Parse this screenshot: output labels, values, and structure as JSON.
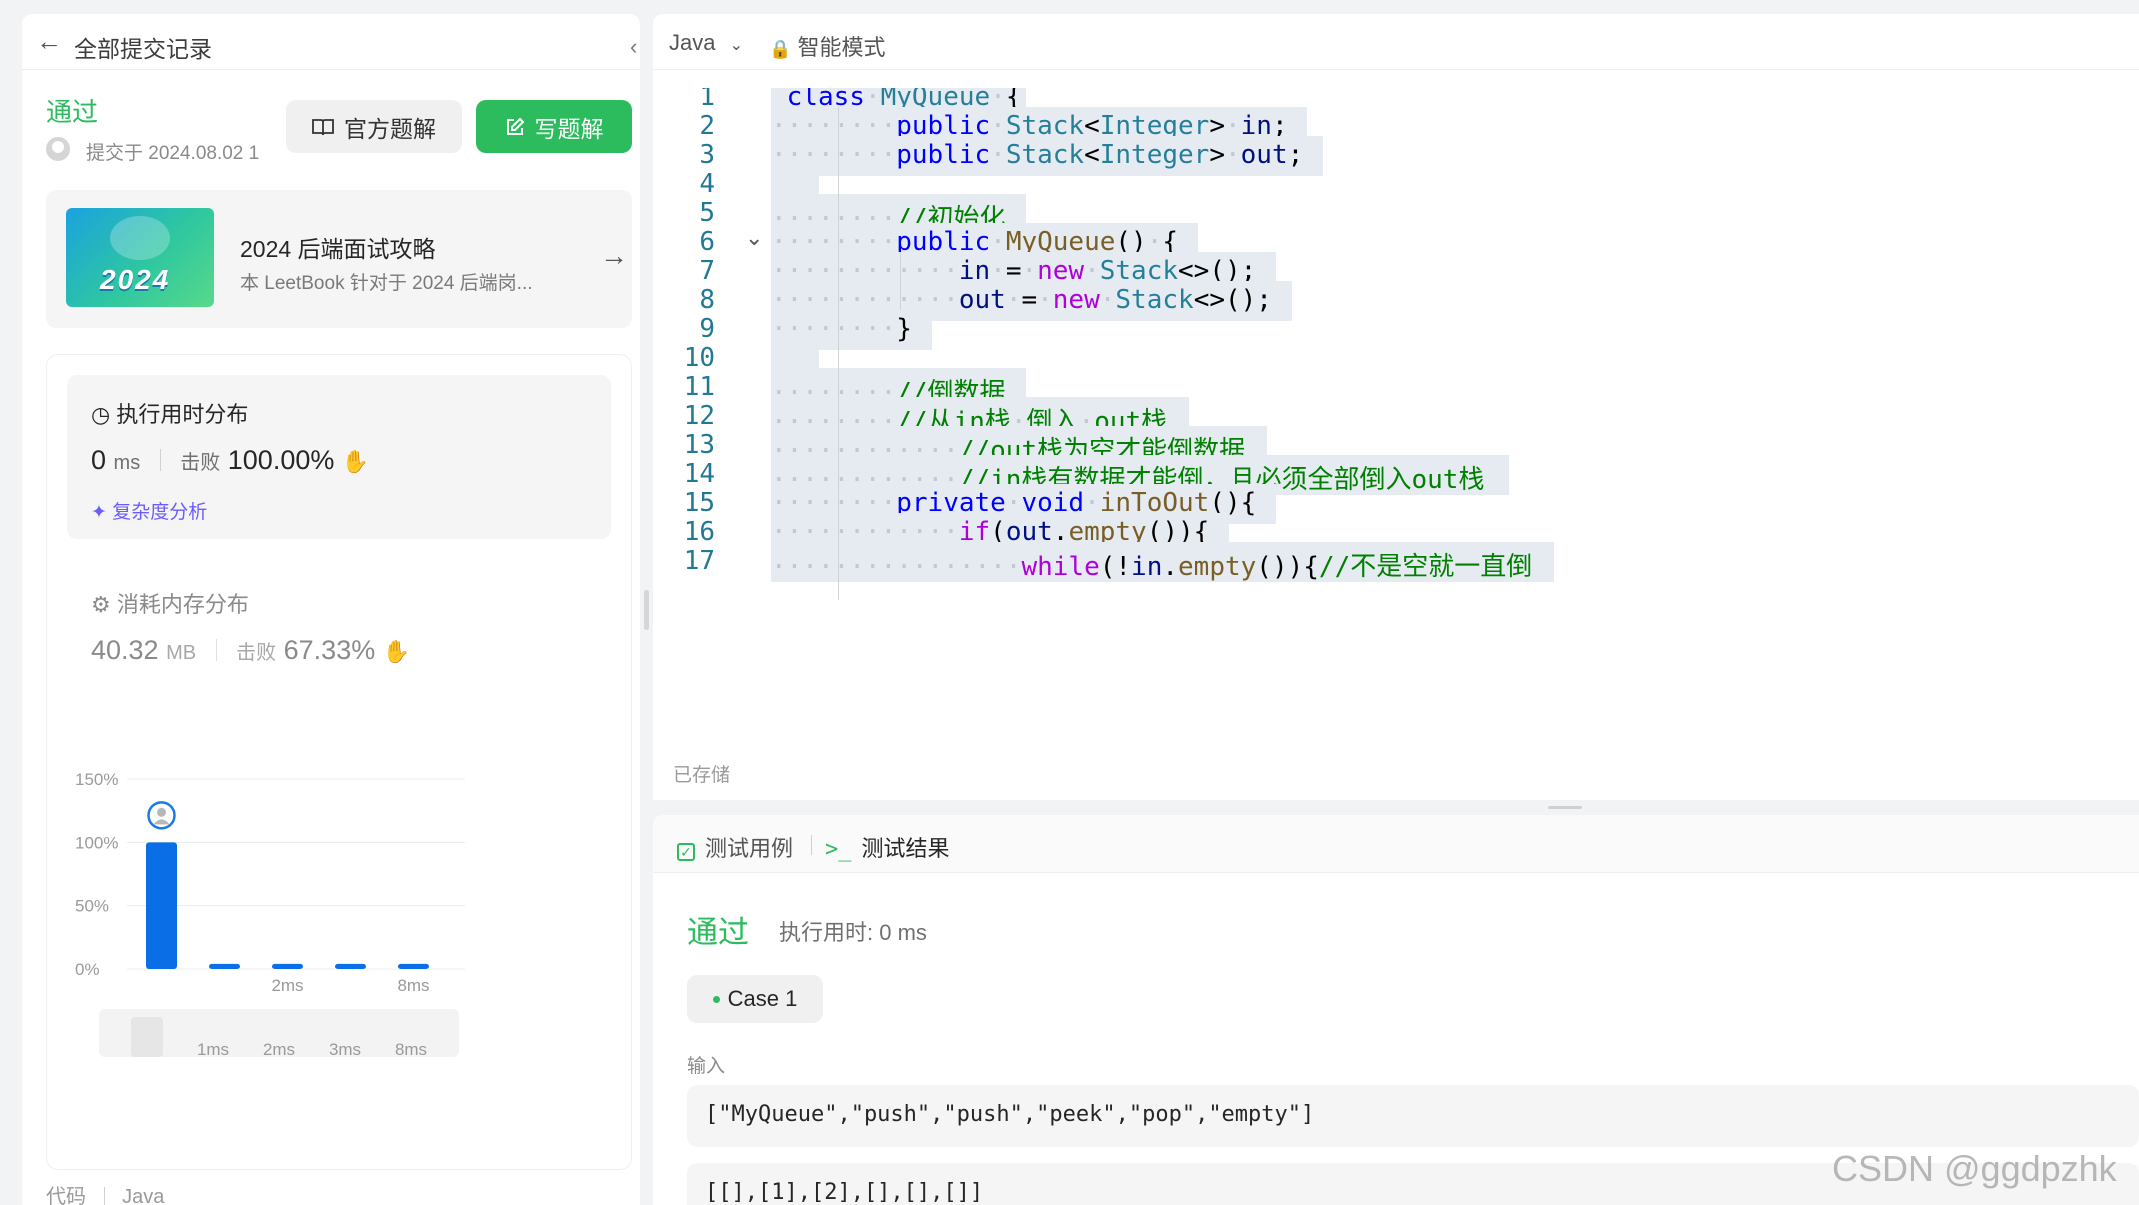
{
  "left_panel": {
    "back_title": "全部提交记录",
    "status": "通过",
    "submitted_at": "提交于 2024.08.02 1",
    "official_solution_label": "官方题解",
    "write_solution_label": "写题解",
    "book": {
      "cover_year": "2024",
      "title": "2024 后端面试攻略",
      "description": "本 LeetBook 针对于 2024 后端岗..."
    },
    "runtime": {
      "title": "执行用时分布",
      "value": "0",
      "unit": "ms",
      "beat_label": "击败",
      "beat_pct": "100.00%",
      "complexity_link": "复杂度分析"
    },
    "memory": {
      "title": "消耗内存分布",
      "value": "40.32",
      "unit": "MB",
      "beat_label": "击败",
      "beat_pct": "67.33%"
    },
    "code_label": "代码",
    "code_lang": "Java"
  },
  "chart_data": {
    "type": "bar",
    "y_ticks": [
      "150%",
      "100%",
      "50%",
      "0%"
    ],
    "ylim": [
      0,
      150
    ],
    "x_labels_main": [
      "",
      "2ms",
      "",
      "8ms"
    ],
    "x_labels_overview": [
      "1ms",
      "2ms",
      "3ms",
      "8ms"
    ],
    "values": [
      100,
      4,
      4,
      4,
      4
    ],
    "colors": {
      "bar": "#0a6fe6",
      "overview_handle": "#e6e6e6"
    }
  },
  "editor": {
    "language": "Java",
    "smart_mode": "智能模式",
    "saved_label": "已存储",
    "lines": [
      {
        "n": "1",
        "indent": 0,
        "tokens": [
          [
            "kw",
            "class"
          ],
          [
            "sp",
            " "
          ],
          [
            "ty",
            "MyQueue"
          ],
          [
            "sp",
            " "
          ],
          [
            "pl",
            "{"
          ]
        ]
      },
      {
        "n": "2",
        "indent": 2,
        "tokens": [
          [
            "kw",
            "public"
          ],
          [
            "sp",
            " "
          ],
          [
            "ty",
            "Stack"
          ],
          [
            "pl",
            "<"
          ],
          [
            "ty",
            "Integer"
          ],
          [
            "pl",
            ">"
          ],
          [
            "sp",
            " "
          ],
          [
            "id",
            "in"
          ],
          [
            "pl",
            ";"
          ]
        ]
      },
      {
        "n": "3",
        "indent": 2,
        "tokens": [
          [
            "kw",
            "public"
          ],
          [
            "sp",
            " "
          ],
          [
            "ty",
            "Stack"
          ],
          [
            "pl",
            "<"
          ],
          [
            "ty",
            "Integer"
          ],
          [
            "pl",
            ">"
          ],
          [
            "sp",
            " "
          ],
          [
            "id",
            "out"
          ],
          [
            "pl",
            ";"
          ]
        ]
      },
      {
        "n": "4",
        "indent": 0,
        "tokens": []
      },
      {
        "n": "5",
        "indent": 2,
        "tokens": [
          [
            "cm",
            "//初始化"
          ]
        ]
      },
      {
        "n": "6",
        "indent": 2,
        "fold": true,
        "tokens": [
          [
            "kw",
            "public"
          ],
          [
            "sp",
            " "
          ],
          [
            "fn",
            "MyQueue"
          ],
          [
            "pl",
            "()"
          ],
          [
            "sp",
            " "
          ],
          [
            "pl",
            "{"
          ]
        ]
      },
      {
        "n": "7",
        "indent": 3,
        "tokens": [
          [
            "id",
            "in"
          ],
          [
            "sp",
            " "
          ],
          [
            "pl",
            "="
          ],
          [
            "sp",
            " "
          ],
          [
            "kw2",
            "new"
          ],
          [
            "sp",
            " "
          ],
          [
            "ty",
            "Stack"
          ],
          [
            "pl",
            "<>();"
          ]
        ]
      },
      {
        "n": "8",
        "indent": 3,
        "tokens": [
          [
            "id",
            "out"
          ],
          [
            "sp",
            " "
          ],
          [
            "pl",
            "="
          ],
          [
            "sp",
            " "
          ],
          [
            "kw2",
            "new"
          ],
          [
            "sp",
            " "
          ],
          [
            "ty",
            "Stack"
          ],
          [
            "pl",
            "<>();"
          ]
        ]
      },
      {
        "n": "9",
        "indent": 2,
        "tokens": [
          [
            "pl",
            "}"
          ]
        ]
      },
      {
        "n": "10",
        "indent": 0,
        "tokens": []
      },
      {
        "n": "11",
        "indent": 2,
        "tokens": [
          [
            "cm",
            "//倒数据"
          ]
        ]
      },
      {
        "n": "12",
        "indent": 2,
        "tokens": [
          [
            "cm",
            "//从in栈"
          ],
          [
            "sp",
            " "
          ],
          [
            "cm",
            "倒入"
          ],
          [
            "sp",
            " "
          ],
          [
            "cm",
            "out栈"
          ]
        ]
      },
      {
        "n": "13",
        "indent": 3,
        "tokens": [
          [
            "cm",
            "//out栈为空才能倒数据"
          ]
        ]
      },
      {
        "n": "14",
        "indent": 3,
        "tokens": [
          [
            "cm",
            "//in栈有数据才能倒，且必须全部倒入out栈"
          ]
        ]
      },
      {
        "n": "15",
        "indent": 2,
        "tokens": [
          [
            "kw",
            "private"
          ],
          [
            "sp",
            " "
          ],
          [
            "kw",
            "void"
          ],
          [
            "sp",
            " "
          ],
          [
            "fn",
            "inToOut"
          ],
          [
            "pl",
            "(){"
          ]
        ]
      },
      {
        "n": "16",
        "indent": 3,
        "tokens": [
          [
            "kw2",
            "if"
          ],
          [
            "pl",
            "("
          ],
          [
            "id",
            "out"
          ],
          [
            "pl",
            "."
          ],
          [
            "fn",
            "empty"
          ],
          [
            "pl",
            "()){"
          ]
        ]
      },
      {
        "n": "17",
        "indent": 4,
        "tokens": [
          [
            "kw2",
            "while"
          ],
          [
            "pl",
            "(!"
          ],
          [
            "id",
            "in"
          ],
          [
            "pl",
            "."
          ],
          [
            "fn",
            "empty"
          ],
          [
            "pl",
            "()){"
          ],
          [
            "cm",
            "//不是空就一直倒"
          ]
        ]
      }
    ]
  },
  "result_panel": {
    "tab_cases": "测试用例",
    "tab_results": "测试结果",
    "status": "通过",
    "runtime": "执行用时: 0 ms",
    "case_label": "Case 1",
    "input_label": "输入",
    "input_line1": "[\"MyQueue\",\"push\",\"push\",\"peek\",\"pop\",\"empty\"]",
    "input_line2": "[[],[1],[2],[],[],[]]"
  },
  "watermark": "CSDN @ggdpzhk",
  "colors": {
    "accent_green": "#2cbb5d",
    "link_purple": "#6a5cff",
    "bar_blue": "#0a6fe6"
  }
}
